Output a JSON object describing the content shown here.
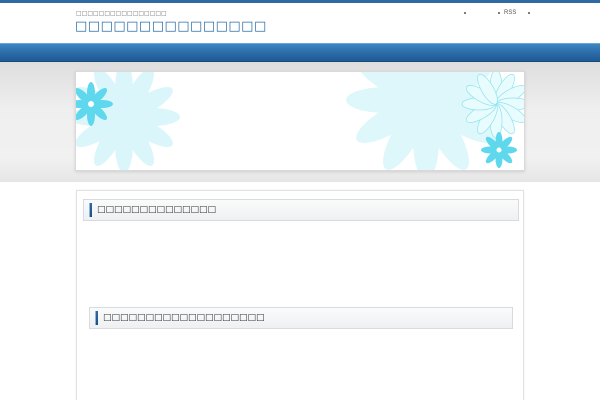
{
  "header": {
    "tagline": "□□□□□□□□□□□□□□□□",
    "site_title": "□□□□□□□□□□□□□□□"
  },
  "top_links": [
    {
      "label": ""
    },
    {
      "label": "RSS"
    }
  ],
  "colors": {
    "brand_blue": "#2f6aa3",
    "nav_blue": "#2a6aa7",
    "flower_cyan": "#5fd8ee"
  },
  "banner": {
    "icon": "flower-pattern"
  },
  "sections": [
    {
      "heading": "□□□□□□□□□□□□□□"
    },
    {
      "heading": "□□□□□□□□□□□□□□□□□□□"
    }
  ]
}
